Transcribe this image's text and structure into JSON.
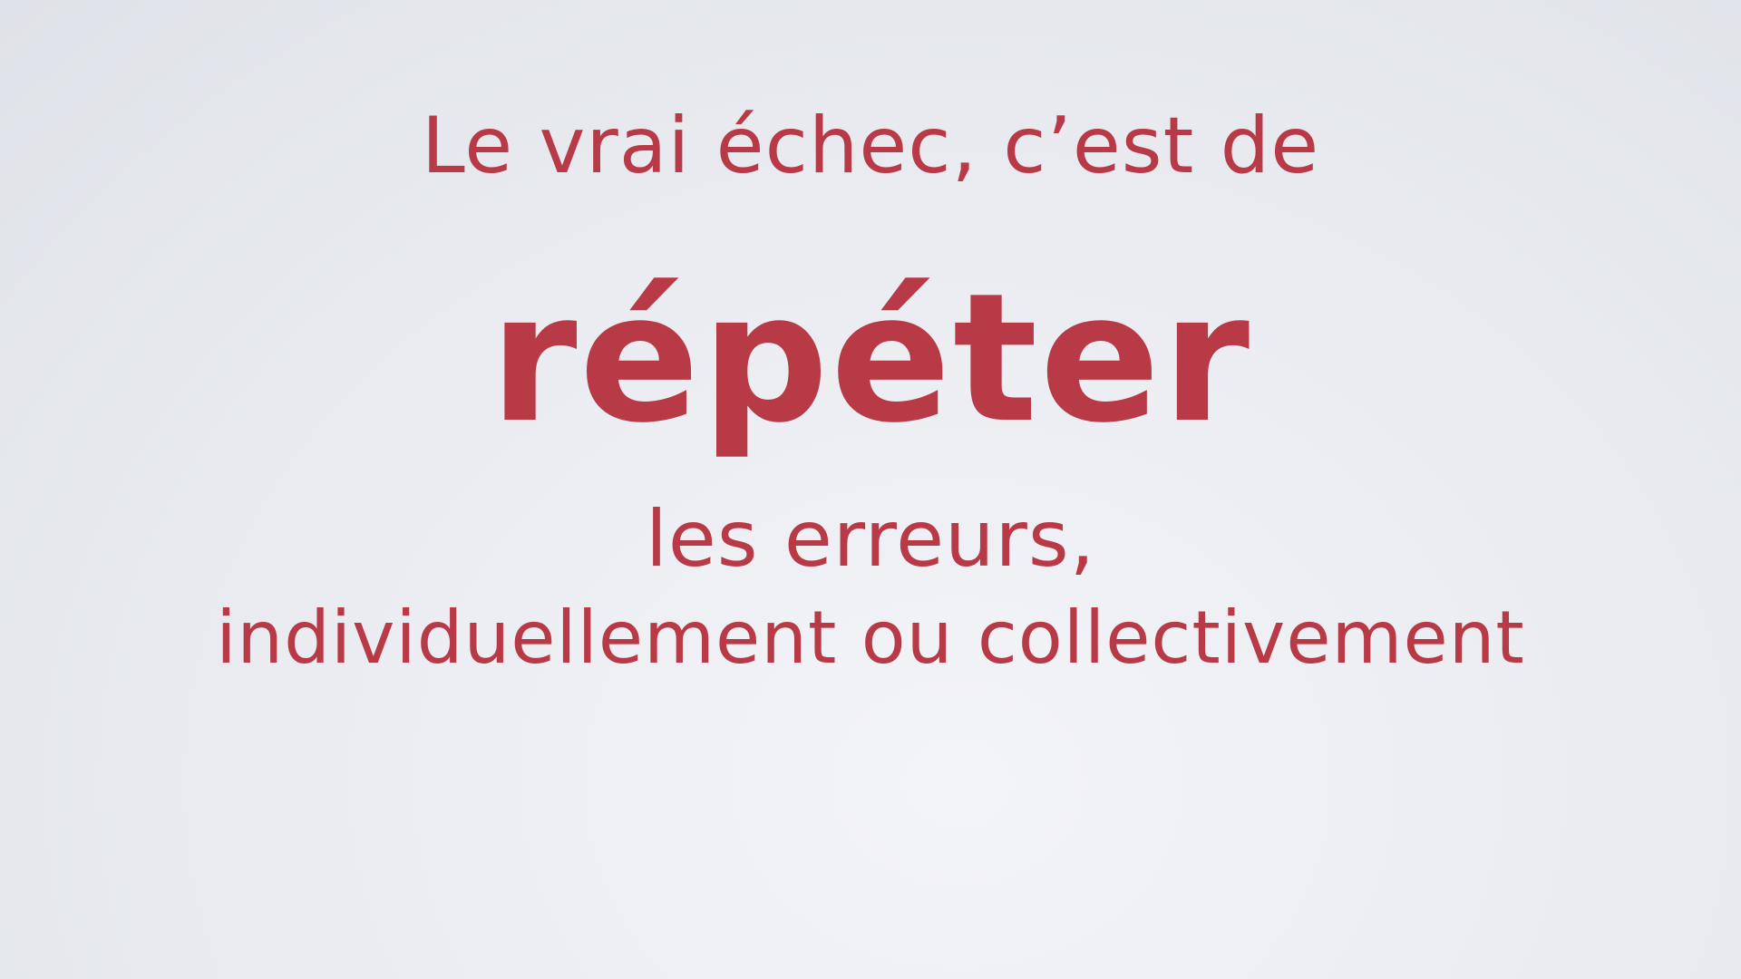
{
  "slide": {
    "line_1": "Le vrai échec, c’est de",
    "line_2": "répéter",
    "line_3": "les erreurs,",
    "line_4": "individuellement ou collectivement"
  },
  "colors": {
    "text": "#b83a47",
    "background": "#eceef2"
  }
}
